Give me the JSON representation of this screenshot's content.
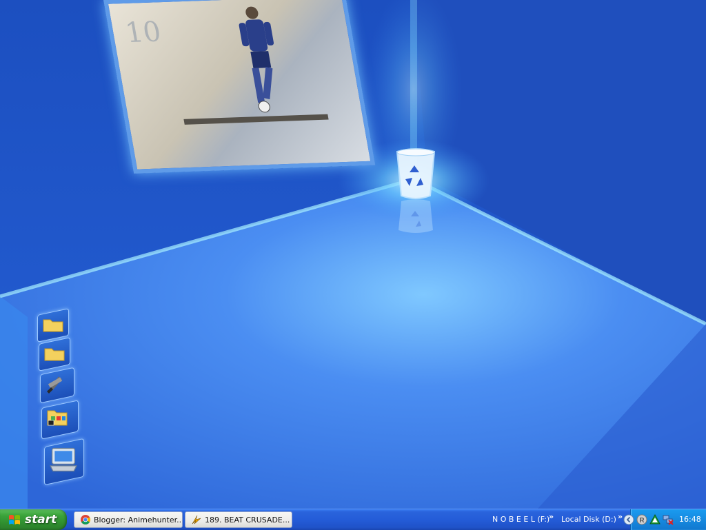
{
  "taskbar": {
    "start_label": "start",
    "tasks": [
      {
        "label": "Blogger: Animehunter...",
        "icon": "chrome-icon"
      },
      {
        "label": "189. BEAT CRUSADE...",
        "icon": "winamp-icon"
      }
    ],
    "toolbars": [
      {
        "label": "N O B E E L  (F:)"
      },
      {
        "label": "Local Disk (D:)"
      }
    ],
    "chevron": "»",
    "clock": "16:48"
  },
  "desktop": {
    "wallpaper_number": "10",
    "icons": [
      "folder-icon",
      "folder-icon",
      "tools-icon",
      "folder-programs-icon",
      "my-computer-icon"
    ],
    "recycle_bin_icon": "recycle-bin-icon"
  },
  "colors": {
    "desktop_blue": "#1d56c6",
    "glow": "#6fd2ff",
    "taskbar": "#245cd8",
    "start_green": "#3ba33b",
    "tray": "#168ae0"
  }
}
